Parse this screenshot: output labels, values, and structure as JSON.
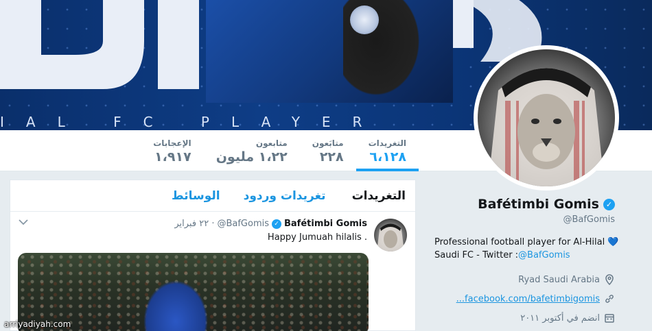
{
  "banner": {
    "tagline": "IAL FC PLAYER",
    "letters": "OMS"
  },
  "stats": [
    {
      "label": "التغريدات",
      "value": "٦،١٢٨",
      "active": true
    },
    {
      "label": "متابَعون",
      "value": "٢٢٨",
      "active": false
    },
    {
      "label": "متابعون",
      "value": "١،٢٢ مليون",
      "active": false
    },
    {
      "label": "الإعجابات",
      "value": "١،٩١٧",
      "active": false
    }
  ],
  "profile": {
    "name": "Bafétimbi Gomis",
    "handle": "@BafGomis",
    "bio_line1": "Professional football player for Al-Hilal",
    "bio_line2_prefix": "Saudi FC - Twitter :",
    "bio_link": "@BafGomis",
    "location": "Ryad Saudi Arabia",
    "website": "...facebook.com/bafetimbigomis",
    "joined": "انضم في أكتوبر ٢٠١١"
  },
  "timeline": {
    "tabs": [
      {
        "label": "التغريدات",
        "active": true
      },
      {
        "label": "تغريدات وردود",
        "active": false
      },
      {
        "label": "الوسائط",
        "active": false
      }
    ],
    "tweet": {
      "name": "Bafétimbi Gomis",
      "handle": "@BafGomis",
      "date": "· ٢٢ فبراير",
      "text": "Happy Jumuah hilalis ."
    }
  },
  "watermark": "arriyadiyah.com",
  "colors": {
    "accent": "#1da1f2",
    "link": "#1b95e0",
    "muted": "#657786"
  }
}
